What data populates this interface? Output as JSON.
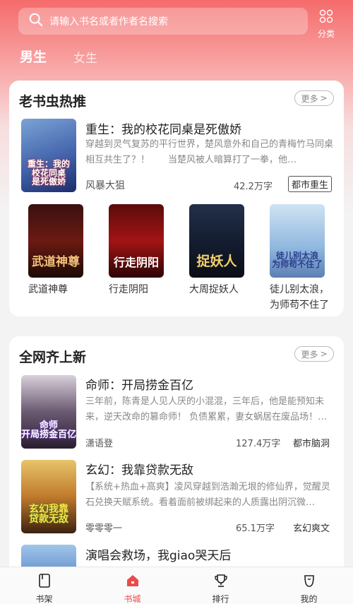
{
  "search": {
    "placeholder": "请输入书名或者作者名搜索"
  },
  "category_label": "分类",
  "gender_tabs": [
    "男生",
    "女生"
  ],
  "section1": {
    "title": "老书虫热推",
    "more": "更多",
    "featured": {
      "title": "重生：我的校花同桌是死傲娇",
      "desc": "穿越到灵气复苏的平行世界，楚风意外和自己的青梅竹马同桌相互共生了？！　　当楚风被人暗算打了一拳，他…",
      "author": "风暴大狙",
      "words": "42.2万字",
      "tag": "都市重生",
      "cover_text": "重生：我的\n校花同桌\n是死傲娇"
    },
    "books": [
      {
        "title": "武道神尊",
        "cover_text": "武道神尊"
      },
      {
        "title": "行走阴阳",
        "cover_text": "行走阴阳"
      },
      {
        "title": "大周捉妖人",
        "cover_text": "捉妖人"
      },
      {
        "title": "徒儿别太浪，为师苟不住了",
        "cover_text": "徒儿别太浪\n为师苟不住了"
      }
    ]
  },
  "section2": {
    "title": "全网齐上新",
    "more": "更多",
    "rows": [
      {
        "title": "命师：开局捞金百亿",
        "desc": "三年前，陈青是人见人厌的小混混，三年后，他是能预知未来，逆天改命的篡命师！ 负债累累，妻女蜗居在废品场！…",
        "author": "潇语登",
        "words": "127.4万字",
        "tag": "都市脑洞",
        "cover_text": "命师\n开局捞金百亿"
      },
      {
        "title": "玄幻：我靠贷款无敌",
        "desc": "【系统+热血+高爽】凌风穿越到浩瀚无垠的修仙界，觉醒灵石兑换天赋系统。看着面前被绑起来的人质露出阴沉微…",
        "author": "零零零一",
        "words": "65.1万字",
        "tag": "玄幻爽文",
        "cover_text": "玄幻我靠\n贷款无敌"
      },
      {
        "title": "演唱会救场，我giao哭天后",
        "cover_text": ""
      }
    ]
  },
  "nav": [
    "书架",
    "书城",
    "排行",
    "我的"
  ],
  "colors": {
    "accent": "#e94b4b",
    "header": "#f56b6b"
  }
}
